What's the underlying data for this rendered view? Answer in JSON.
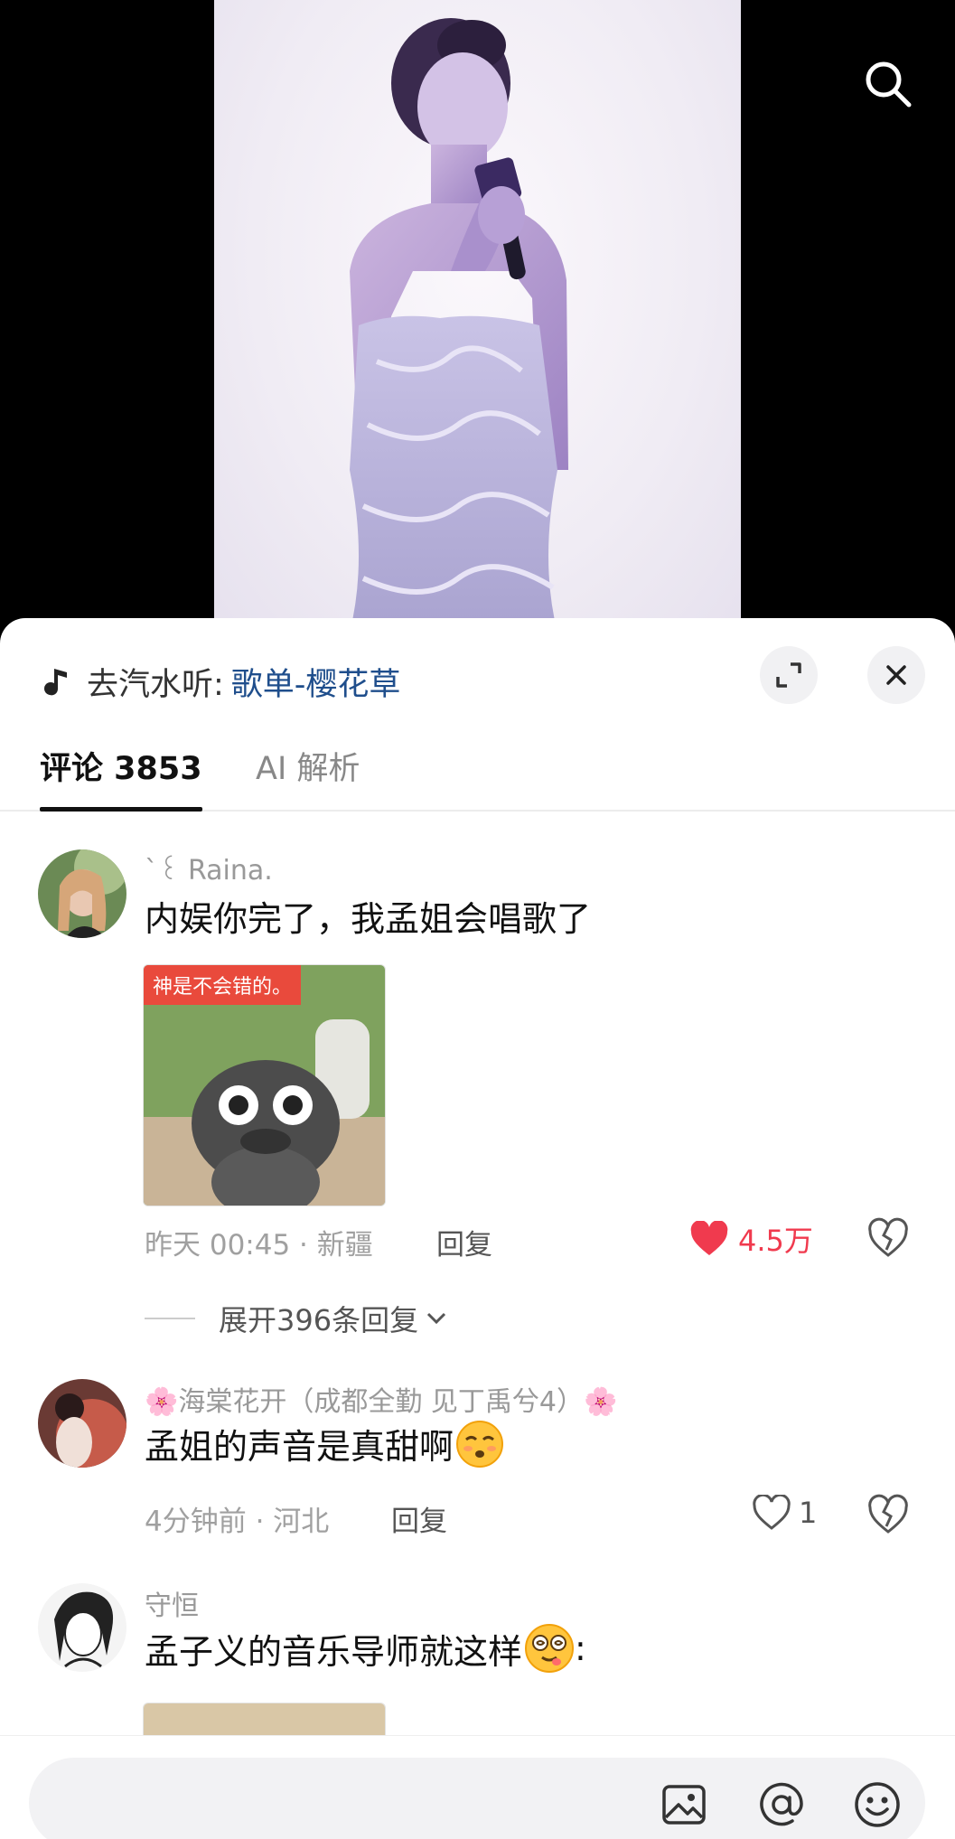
{
  "music": {
    "prefix": "去汽水听:",
    "link": "歌单-樱花草"
  },
  "tabs": {
    "comments": "评论 3853",
    "ai": "AI 解析"
  },
  "comments": [
    {
      "username": "ˋ꒰ Raina.",
      "text": "内娱你完了，我孟姐会唱歌了",
      "sticker_caption": "神是不会错的。",
      "meta": "昨天 00:45 · 新疆",
      "reply": "回复",
      "likes": "4.5万",
      "liked": true
    },
    {
      "username": "🌸海棠花开（成都全勤 见丁禹兮4）🌸",
      "text": "孟姐的声音是真甜啊",
      "meta": "4分钟前 · 河北",
      "reply": "回复",
      "likes": "1",
      "liked": false
    },
    {
      "username": "守恒",
      "text": "孟子义的音乐导师就这样",
      "text_suffix": ":"
    }
  ],
  "expand_replies": "展开396条回复",
  "colors": {
    "like_red": "#f03a4e",
    "link_blue": "#1f4e8c"
  }
}
